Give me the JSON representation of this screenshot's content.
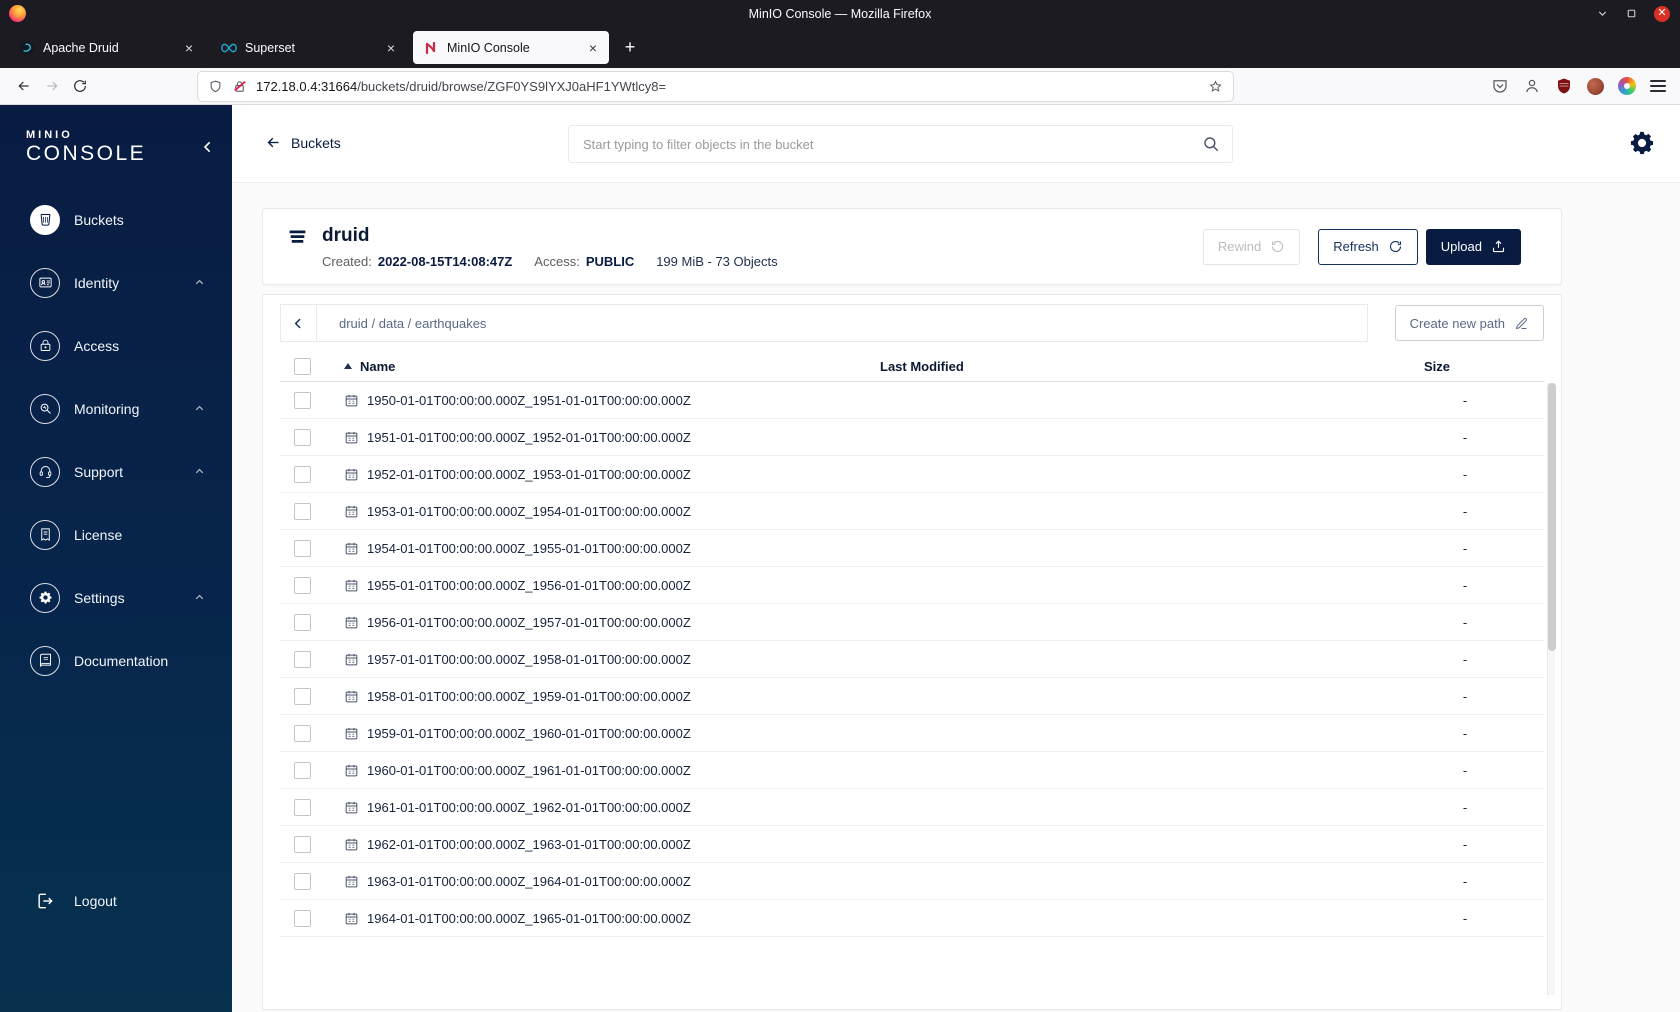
{
  "colors": {
    "sidebar_navy": "#081C42",
    "primary_button": "#081C42",
    "accent_red": "#C72C48"
  },
  "window": {
    "title": "MinIO Console — Mozilla Firefox",
    "tabs": [
      {
        "label": "Apache Druid",
        "icon": "druid",
        "active": false
      },
      {
        "label": "Superset",
        "icon": "superset",
        "active": false
      },
      {
        "label": "MinIO Console",
        "icon": "minio",
        "active": true
      }
    ],
    "new_tab_button": "+",
    "url_host": "172.18.0.4:31664",
    "url_path": "/buckets/druid/browse/ZGF0YS9lYXJ0aHF1YWtlcy8="
  },
  "sidebar": {
    "logo_top": "MINIO",
    "logo_bottom": "CONSOLE",
    "items": [
      {
        "label": "Buckets",
        "icon": "bucket",
        "active": true,
        "chevron": false
      },
      {
        "label": "Identity",
        "icon": "identity",
        "active": false,
        "chevron": true
      },
      {
        "label": "Access",
        "icon": "access",
        "active": false,
        "chevron": false
      },
      {
        "label": "Monitoring",
        "icon": "monitoring",
        "active": false,
        "chevron": true
      },
      {
        "label": "Support",
        "icon": "support",
        "active": false,
        "chevron": true
      },
      {
        "label": "License",
        "icon": "license",
        "active": false,
        "chevron": false
      },
      {
        "label": "Settings",
        "icon": "settings",
        "active": false,
        "chevron": true
      },
      {
        "label": "Documentation",
        "icon": "documentation",
        "active": false,
        "chevron": false
      }
    ],
    "logout": {
      "label": "Logout",
      "icon": "logout"
    }
  },
  "header": {
    "back_label": "Buckets",
    "search_placeholder": "Start typing to filter objects in the bucket"
  },
  "bucket": {
    "name": "druid",
    "created_label": "Created:",
    "created_value": "2022-08-15T14:08:47Z",
    "access_label": "Access:",
    "access_value": "PUBLIC",
    "summary": "199 MiB - 73 Objects",
    "buttons": {
      "rewind": "Rewind",
      "refresh": "Refresh",
      "upload": "Upload"
    }
  },
  "path_bar": {
    "breadcrumb": "druid / data / earthquakes",
    "create_label": "Create new path"
  },
  "table": {
    "headers": {
      "name": "Name",
      "last_modified": "Last Modified",
      "size": "Size"
    },
    "rows": [
      {
        "name": "1950-01-01T00:00:00.000Z_1951-01-01T00:00:00.000Z",
        "size": "-"
      },
      {
        "name": "1951-01-01T00:00:00.000Z_1952-01-01T00:00:00.000Z",
        "size": "-"
      },
      {
        "name": "1952-01-01T00:00:00.000Z_1953-01-01T00:00:00.000Z",
        "size": "-"
      },
      {
        "name": "1953-01-01T00:00:00.000Z_1954-01-01T00:00:00.000Z",
        "size": "-"
      },
      {
        "name": "1954-01-01T00:00:00.000Z_1955-01-01T00:00:00.000Z",
        "size": "-"
      },
      {
        "name": "1955-01-01T00:00:00.000Z_1956-01-01T00:00:00.000Z",
        "size": "-"
      },
      {
        "name": "1956-01-01T00:00:00.000Z_1957-01-01T00:00:00.000Z",
        "size": "-"
      },
      {
        "name": "1957-01-01T00:00:00.000Z_1958-01-01T00:00:00.000Z",
        "size": "-"
      },
      {
        "name": "1958-01-01T00:00:00.000Z_1959-01-01T00:00:00.000Z",
        "size": "-"
      },
      {
        "name": "1959-01-01T00:00:00.000Z_1960-01-01T00:00:00.000Z",
        "size": "-"
      },
      {
        "name": "1960-01-01T00:00:00.000Z_1961-01-01T00:00:00.000Z",
        "size": "-"
      },
      {
        "name": "1961-01-01T00:00:00.000Z_1962-01-01T00:00:00.000Z",
        "size": "-"
      },
      {
        "name": "1962-01-01T00:00:00.000Z_1963-01-01T00:00:00.000Z",
        "size": "-"
      },
      {
        "name": "1963-01-01T00:00:00.000Z_1964-01-01T00:00:00.000Z",
        "size": "-"
      },
      {
        "name": "1964-01-01T00:00:00.000Z_1965-01-01T00:00:00.000Z",
        "size": "-"
      }
    ]
  }
}
